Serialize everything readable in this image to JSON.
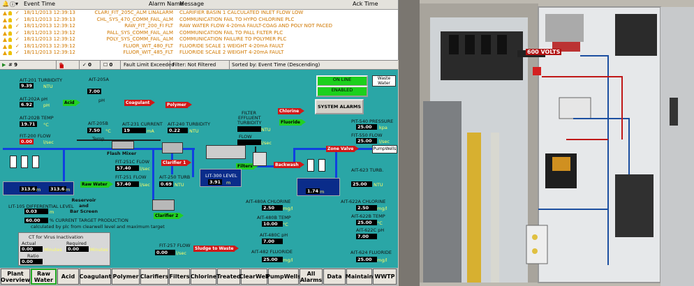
{
  "alarms": {
    "headers": {
      "time": "Event Time",
      "name": "Alarm Name",
      "message": "Message",
      "ack": "Ack Time"
    },
    "rows": [
      {
        "time": "18/11/2013 12:39:13",
        "name": "CLARI_FIT_205C_ALM LINALARM",
        "message": "CLARIFIER BASIN 1 CALCULATED INLET FLOW LOW"
      },
      {
        "time": "18/11/2013 12:39:13",
        "name": "CHL_SYS_470_COMM_FAIL_ALM",
        "message": "COMMUNICATION FAIL TO HYPO CHLORINE PLC"
      },
      {
        "time": "18/11/2013 12:39:12",
        "name": "RAW_FIT_200_FI FLT",
        "message": "RAW WATER FLOW 4-20mA FAULT-COAG AND POLY NOT PACED"
      },
      {
        "time": "18/11/2013 12:39:12",
        "name": "PALL_SYS_COMM_FAIL_ALM",
        "message": "COMMUNICATION FAIL TO PALL FILTER PLC"
      },
      {
        "time": "18/11/2013 12:39:12",
        "name": "POLY_SYS_COMM_FAIL_ALM",
        "message": "COMMUNICATION FAILURE TO POLYMER PLC"
      },
      {
        "time": "18/11/2013 12:39:12",
        "name": "FLUOR_WIT_480_FLT",
        "message": "FLUORIDE SCALE 1 WEIGHT 4-20mA FAULT"
      },
      {
        "time": "18/11/2013 12:39:12",
        "name": "FLUOR_WIT_485_FLT",
        "message": "FLUORIDE SCALE 2 WEIGHT 4-20mA FAULT"
      }
    ],
    "status": {
      "count": "9",
      "bells": "9",
      "zero1": "0",
      "zero2": "0",
      "fault": "Fault Limit Exceeded",
      "filter": "Filter: Not Filtered",
      "sorted": "Sorted by: Event Time (Descending)"
    }
  },
  "process": {
    "ait201": {
      "label": "AIT-201 TURBIDITY",
      "value": "9.39",
      "unit": "NTU"
    },
    "ait202a": {
      "label": "AIT-202A pH",
      "value": "6.92",
      "unit": "pH"
    },
    "ait202b": {
      "label": "AIT-202B TEMP",
      "value": "19.71",
      "unit": "°C"
    },
    "fit200": {
      "label": "FIT-200 FLOW",
      "value": "0.00",
      "unit": "l/sec"
    },
    "ait205a": {
      "label": "AIT-205A",
      "value": "7.00",
      "unit": "pH"
    },
    "ait205b": {
      "label": "AIT-205B",
      "value": "7.50",
      "unit": "°C",
      "sub": "Temp"
    },
    "ait231": {
      "label": "AIT-231 CURRENT",
      "value": "19",
      "unit": "mA"
    },
    "ait240": {
      "label": "AIT-240 TURBIDITY",
      "value": "0.22",
      "unit": "NTU"
    },
    "fit251c": {
      "label": "FIT-251C FLOW",
      "value": "57.40",
      "unit": "l/sec"
    },
    "fit251": {
      "label": "FIT-251 FLOW",
      "value": "57.40",
      "unit": "l/sec"
    },
    "ait250": {
      "label": "AIT-250 TURB",
      "value": "0.69",
      "unit": "NTU"
    },
    "lit300": {
      "label": "LIT-300 LEVEL",
      "value": "3.91",
      "unit": "m"
    },
    "filter_turb": {
      "label1": "FILTER",
      "label2": "EFFLUENT",
      "label3": "TURBIDITY",
      "unit": "NTU",
      "flow": "FLOW",
      "flowunit": "l/sec"
    },
    "pit540": {
      "label": "PIT-540 PRESSURE",
      "value": "25.00",
      "unit": "kpa"
    },
    "fit550": {
      "label": "FIT-550 FLOW",
      "value": "25.00",
      "unit": "l/sec"
    },
    "ait623": {
      "label": "AIT-623 TURB.",
      "value": "25.00",
      "unit": "NTU"
    },
    "ait622a": {
      "label": "AIT-622A CHLORINE",
      "value": "2.50",
      "unit": "mg/l"
    },
    "ait622b": {
      "label": "AIT-622B TEMP",
      "value": "25.00",
      "unit": "°C"
    },
    "ait622c": {
      "label": "AIT-622C pH",
      "value": "7.00"
    },
    "ait624": {
      "label": "AIT-624 FLUORIDE",
      "value": "25.00",
      "unit": "mg/l"
    },
    "ait480a": {
      "label": "AIT-480A CHLORINE",
      "value": "2.50",
      "unit": "mg/l"
    },
    "ait480b": {
      "label": "AIT-480B TEMP",
      "value": "10.00",
      "unit": "°C"
    },
    "ait480c": {
      "label": "AIT-480C pH",
      "value": "7.00"
    },
    "ait482": {
      "label": "AIT-482 FLUORIDE",
      "value": "25.00",
      "unit": "mg/l"
    },
    "fit257": {
      "label": "FIT-257 FLOW",
      "value": "0.00",
      "unit": "l/sec"
    },
    "lit105": {
      "label": "LIT-105 DIFFERENTIAL LEVEL",
      "value": "0.03",
      "unit": "m"
    },
    "target": {
      "value": "60.00",
      "text": "% CURRENT TARGET PRODUCTION",
      "note": "calculated by plc from clearwell level and maximum target"
    },
    "reservoir": {
      "value1": "313.6",
      "value2": "313.6",
      "unit": "m",
      "label": "Reservoir\nand\nBar Screen"
    },
    "clearwell_level": {
      "value": "1.74",
      "unit": "m"
    },
    "ct": {
      "title": "CT for Virus Inactivation",
      "actual": "Actual",
      "required": "Required",
      "actual_val": "0.00",
      "actual_unit": "Minutes",
      "required_val": "0.00",
      "required_unit": "Minutes",
      "ratio": "Ratio",
      "ratio_val": "0.00"
    },
    "tags": {
      "acid": "Acid",
      "polymer": "Polymer",
      "coagulant": "Coagulant",
      "fluoride": "Fluoride",
      "chlorine": "Chlorine",
      "filters": "Filters",
      "backwash": "Backwash",
      "flash_mixer": "Flash Mixer",
      "clarifier1": "Clarifier 1",
      "clarifier2": "Clarifier 2",
      "sludge": "Sludge to Waste",
      "raw_water": "Raw Water",
      "pump_wells": "PumpWells",
      "zone_valve": "Zone Valve",
      "waste_water": "Waste Water"
    },
    "controls": {
      "online": "ON LINE",
      "enabled": "ENABLED",
      "system_alarms": "SYSTEM ALARMS"
    }
  },
  "nav": [
    {
      "label": "Plant\nOverview"
    },
    {
      "label": "Raw\nWater",
      "active": true
    },
    {
      "label": "Acid"
    },
    {
      "label": "Coagulant"
    },
    {
      "label": "Polymer"
    },
    {
      "label": "Clarifiers"
    },
    {
      "label": "Filters"
    },
    {
      "label": "Chlorine"
    },
    {
      "label": "Treated"
    },
    {
      "label": "ClearWell"
    },
    {
      "label": "PumpWells"
    },
    {
      "label": "All\nAlarms"
    },
    {
      "label": "Data"
    },
    {
      "label": "Maintain"
    },
    {
      "label": "WWTP"
    }
  ],
  "photo": {
    "sign": "600 VOLTS"
  },
  "colors": {
    "process_bg": "#2aa6a6",
    "pipe": "#1040e0",
    "alarm_text": "#d07800"
  }
}
